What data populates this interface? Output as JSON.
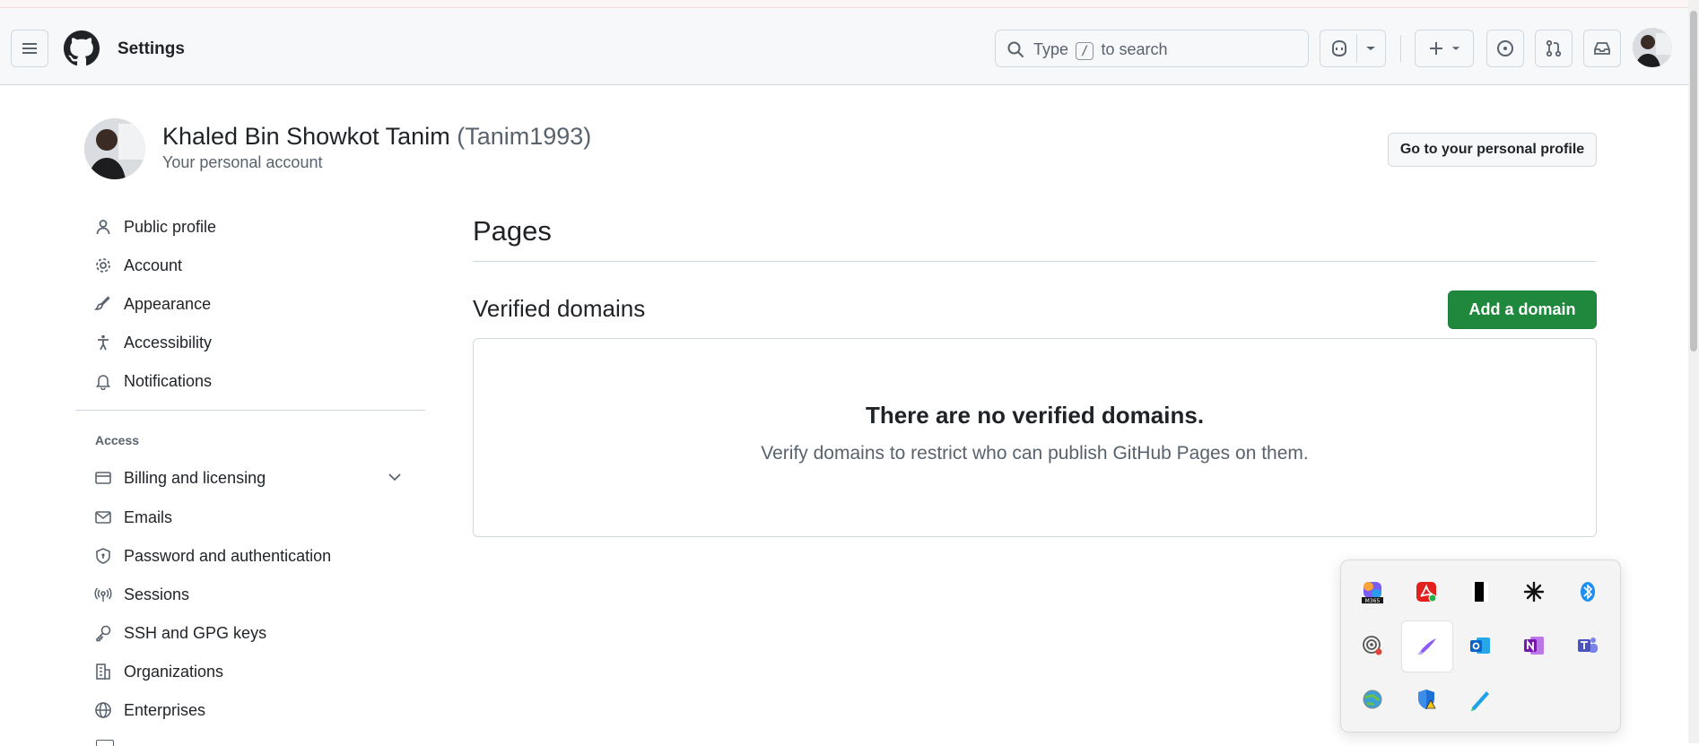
{
  "header": {
    "title": "Settings",
    "search": {
      "prefix": "Type",
      "key": "/",
      "suffix": "to search"
    }
  },
  "profile": {
    "name": "Khaled Bin Showkot Tanim",
    "login": "(Tanim1993)",
    "subtitle": "Your personal account",
    "profile_button": "Go to your personal profile"
  },
  "sidebar": {
    "items": [
      {
        "label": "Public profile",
        "icon": "person-icon"
      },
      {
        "label": "Account",
        "icon": "gear-icon"
      },
      {
        "label": "Appearance",
        "icon": "paintbrush-icon"
      },
      {
        "label": "Accessibility",
        "icon": "accessibility-icon"
      },
      {
        "label": "Notifications",
        "icon": "bell-icon"
      }
    ],
    "access_label": "Access",
    "access_items": [
      {
        "label": "Billing and licensing",
        "icon": "credit-card-icon"
      },
      {
        "label": "Emails",
        "icon": "mail-icon"
      },
      {
        "label": "Password and authentication",
        "icon": "shield-lock-icon"
      },
      {
        "label": "Sessions",
        "icon": "broadcast-icon"
      },
      {
        "label": "SSH and GPG keys",
        "icon": "key-icon"
      },
      {
        "label": "Organizations",
        "icon": "organization-icon"
      },
      {
        "label": "Enterprises",
        "icon": "globe-icon"
      }
    ]
  },
  "main": {
    "title": "Pages",
    "section_title": "Verified domains",
    "add_button": "Add a domain",
    "blankslate": {
      "heading": "There are no verified domains.",
      "description": "Verify domains to restrict who can publish GitHub Pages on them."
    }
  },
  "tray": {
    "icons": [
      "microsoft-365-copilot-icon",
      "acrobat-icon",
      "black-rectangle-app-icon",
      "asterisk-app-icon",
      "bluetooth-icon",
      "podcast-recording-icon",
      "pen-app-icon",
      "outlook-icon",
      "onenote-icon",
      "teams-icon",
      "globe-sync-icon",
      "defender-warning-icon",
      "stylus-app-icon"
    ]
  },
  "colors": {
    "primary": "#1f883d",
    "text": "#1f2328",
    "muted": "#59636e",
    "border": "#d1d9e0"
  }
}
